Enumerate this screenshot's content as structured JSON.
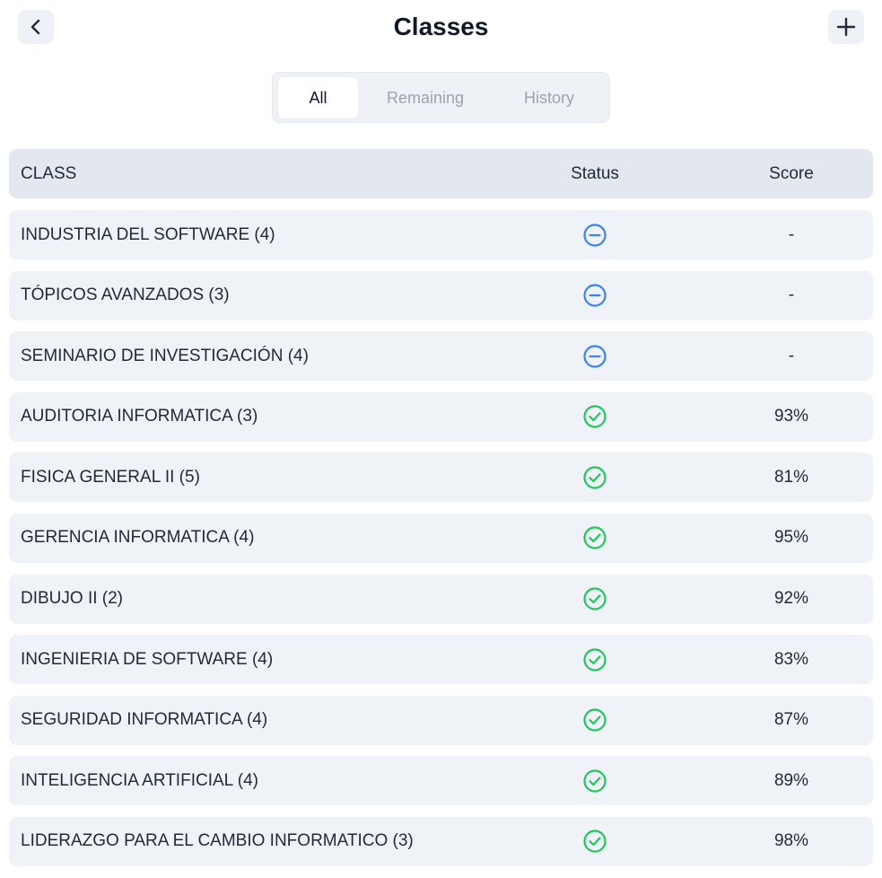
{
  "header": {
    "title": "Classes",
    "back_icon": "chevron-left-icon",
    "add_icon": "plus-icon"
  },
  "tabs": [
    {
      "label": "All",
      "active": true
    },
    {
      "label": "Remaining",
      "active": false
    },
    {
      "label": "History",
      "active": false
    }
  ],
  "table": {
    "headers": {
      "class": "CLASS",
      "status": "Status",
      "score": "Score"
    },
    "rows": [
      {
        "class": "INDUSTRIA DEL SOFTWARE (4)",
        "status": "in-progress",
        "score": "-"
      },
      {
        "class": "TÓPICOS AVANZADOS (3)",
        "status": "in-progress",
        "score": "-"
      },
      {
        "class": "SEMINARIO DE INVESTIGACIÓN (4)",
        "status": "in-progress",
        "score": "-"
      },
      {
        "class": "AUDITORIA INFORMATICA (3)",
        "status": "completed",
        "score": "93%"
      },
      {
        "class": "FISICA GENERAL II (5)",
        "status": "completed",
        "score": "81%"
      },
      {
        "class": "GERENCIA INFORMATICA (4)",
        "status": "completed",
        "score": "95%"
      },
      {
        "class": "DIBUJO II (2)",
        "status": "completed",
        "score": "92%"
      },
      {
        "class": "INGENIERIA DE SOFTWARE (4)",
        "status": "completed",
        "score": "83%"
      },
      {
        "class": "SEGURIDAD INFORMATICA (4)",
        "status": "completed",
        "score": "87%"
      },
      {
        "class": "INTELIGENCIA ARTIFICIAL (4)",
        "status": "completed",
        "score": "89%"
      },
      {
        "class": "LIDERAZGO PARA EL CAMBIO INFORMATICO (3)",
        "status": "completed",
        "score": "98%"
      }
    ]
  },
  "colors": {
    "in_progress_icon": "#3b82f6",
    "completed_icon": "#22c55e",
    "row_background": "#eff2f7",
    "header_background": "#e3e8f0",
    "tab_background": "#eef1f6"
  }
}
